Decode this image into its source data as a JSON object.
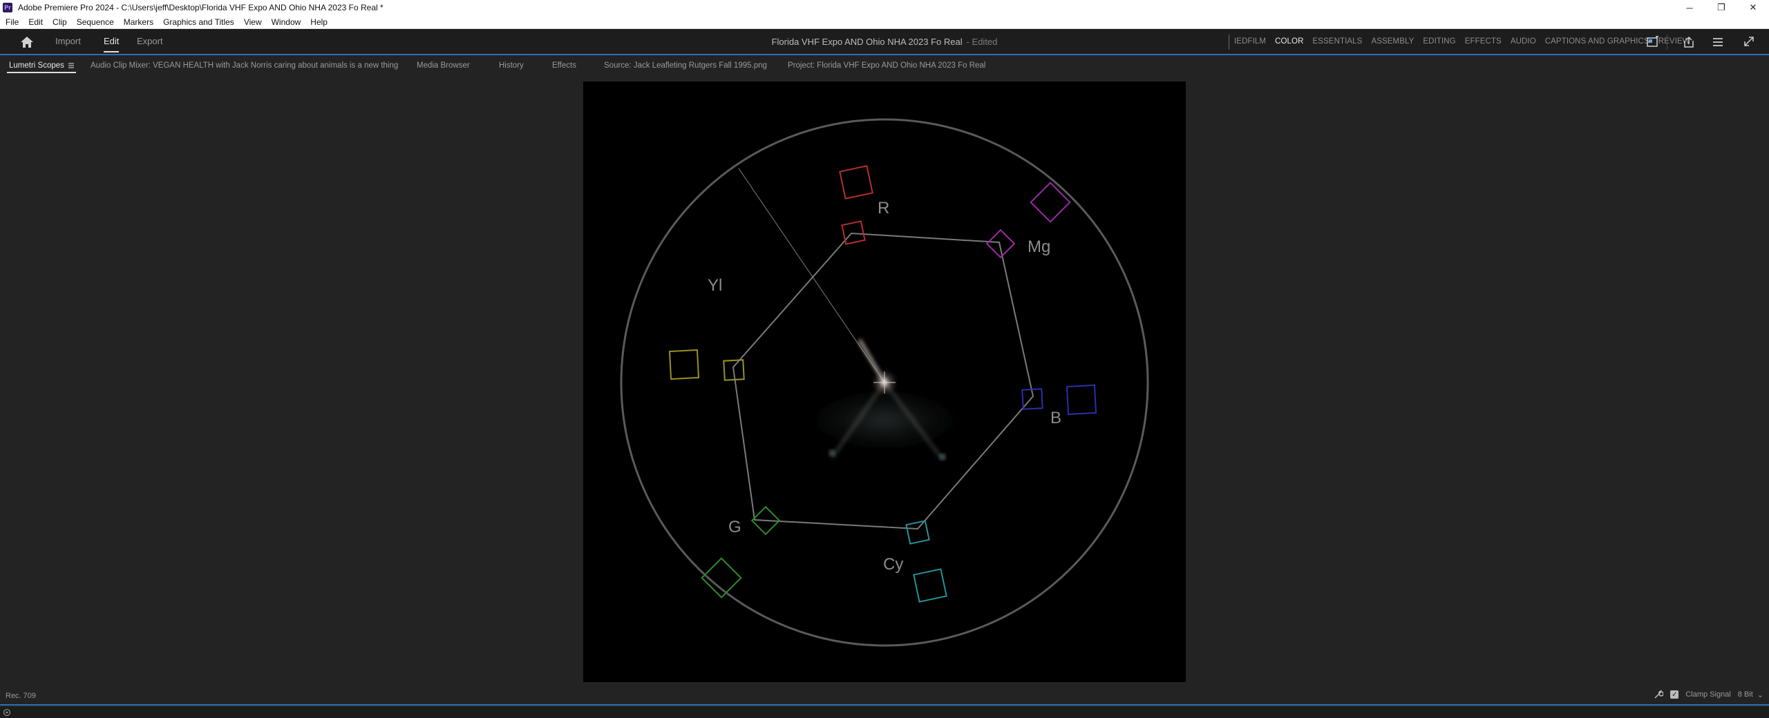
{
  "window": {
    "title": "Adobe Premiere Pro 2024 - C:\\Users\\jeff\\Desktop\\Florida VHF Expo AND Ohio NHA 2023 Fo Real *",
    "app_icon": "Pr",
    "controls": {
      "minimize": "─",
      "restore": "❐",
      "close": "✕"
    }
  },
  "menu": [
    "File",
    "Edit",
    "Clip",
    "Sequence",
    "Markers",
    "Graphics and Titles",
    "View",
    "Window",
    "Help"
  ],
  "header": {
    "tabs": [
      "Import",
      "Edit",
      "Export"
    ],
    "active_tab": "Edit",
    "doc_title": "Florida VHF Expo AND Ohio NHA 2023 Fo Real",
    "doc_status": "- Edited",
    "workspaces": [
      "IEDFILM",
      "COLOR",
      "ESSENTIALS",
      "ASSEMBLY",
      "EDITING",
      "EFFECTS",
      "AUDIO",
      "CAPTIONS AND GRAPHICS",
      "REVIEW"
    ],
    "active_workspace": "COLOR"
  },
  "panel_tabs": [
    "Lumetri Scopes",
    "Audio Clip Mixer: VEGAN HEALTH with Jack Norris caring about animals is a new thing",
    "Media Browser",
    "History",
    "Effects",
    "Source: Jack Leafleting Rutgers Fall 1995.png",
    "Project: Florida VHF Expo AND Ohio NHA 2023 Fo Real"
  ],
  "scope": {
    "type": "vectorscope",
    "labels": {
      "r": "R",
      "mg": "Mg",
      "b": "B",
      "cy": "Cy",
      "g": "G",
      "yl": "Yl"
    },
    "colors": {
      "r": "#b3302c",
      "mg": "#9a2ba6",
      "b": "#2a2fa8",
      "cy": "#2a8f96",
      "g": "#2e8a2a",
      "yl": "#9a9122",
      "graticule": "#5a5a5a",
      "label": "#8c8c8c"
    }
  },
  "footer": {
    "standard": "Rec. 709",
    "clamp_label": "Clamp Signal",
    "clamp_checked": true,
    "bit_depth": "8 Bit"
  }
}
